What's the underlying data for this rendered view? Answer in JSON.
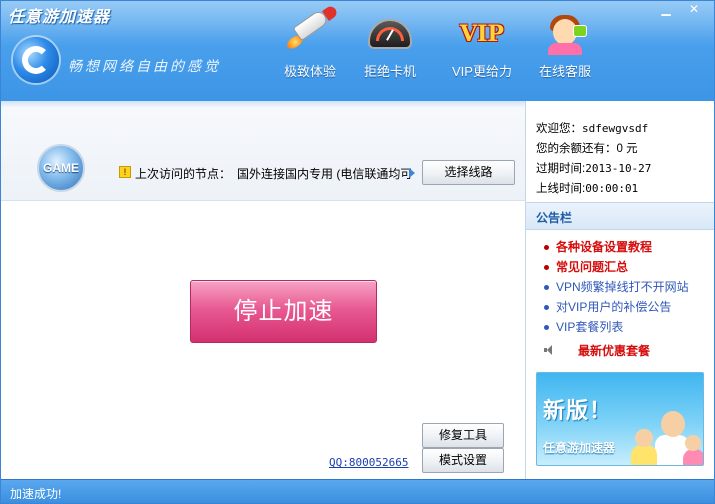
{
  "window": {
    "title": "任意游加速器",
    "minimize_label": "▁",
    "close_label": "✕"
  },
  "header": {
    "slogan": "畅想网络自由的感觉",
    "nav": [
      {
        "label": "极致体验",
        "icon": "rocket-icon"
      },
      {
        "label": "拒绝卡机",
        "icon": "speed-gauge-icon"
      },
      {
        "label": "VIP更给力",
        "icon": "vip-icon"
      },
      {
        "label": "在线客服",
        "icon": "customer-service-icon"
      }
    ],
    "vip_icon_text": "VIP"
  },
  "node": {
    "badge": "GAME",
    "label": "上次访问的节点：",
    "value": "国外连接国内专用 (电信联通均可)",
    "select_button": "选择线路"
  },
  "main": {
    "stop_button": "停止加速",
    "repair_button": "修复工具",
    "mode_button": "模式设置",
    "qq_link": "QQ:800052665"
  },
  "user": {
    "welcome_label": "欢迎您：",
    "username": "sdfewgvsdf",
    "balance_label": "您的余额还有：",
    "balance": "0 元",
    "expire_label": "过期时间:",
    "expire_value": "2013-10-27",
    "online_label": "上线时间:",
    "online_value": "00:00:01"
  },
  "board": {
    "title": "公告栏",
    "items": [
      {
        "text": "各种设备设置教程",
        "style": "red"
      },
      {
        "text": "常见问题汇总",
        "style": "red"
      },
      {
        "text": "VPN频繁掉线打不开网站",
        "style": "blue"
      },
      {
        "text": "对VIP用户的补偿公告",
        "style": "blue"
      },
      {
        "text": "VIP套餐列表",
        "style": "blue"
      }
    ],
    "promo": "最新优惠套餐"
  },
  "banner": {
    "headline": "新版！",
    "product": "任意游加速器"
  },
  "status": {
    "text": "加速成功!"
  },
  "colors": {
    "header_blue": "#3d95e6",
    "stop_pink": "#e85a93",
    "notice_red": "#d60d0d",
    "notice_blue": "#2f58b8"
  }
}
